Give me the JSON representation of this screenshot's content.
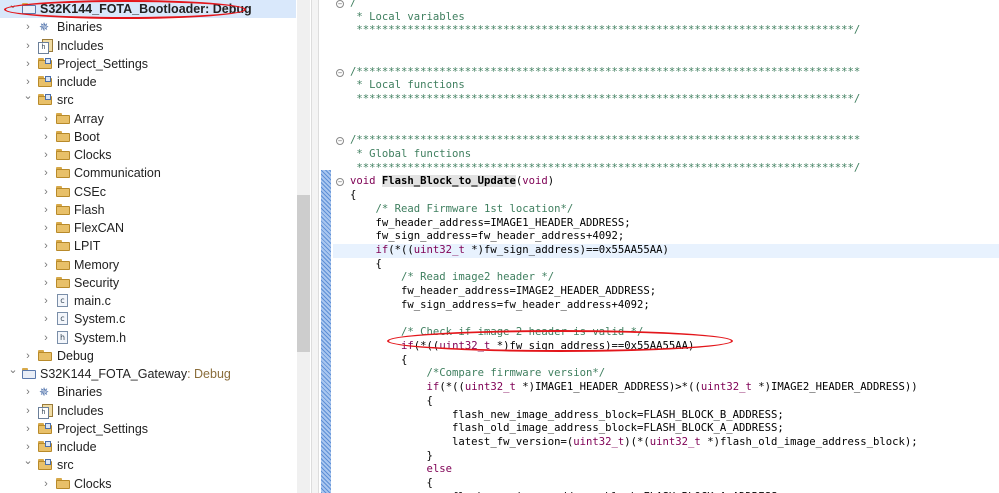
{
  "project_explorer": {
    "rows": [
      {
        "label": "S32K144_FOTA_Bootloader",
        "suffix": ": Debug",
        "icon": "project-folder-icon",
        "level": 0,
        "expanded": true,
        "selected": true
      },
      {
        "label": "Binaries",
        "icon": "binaries-icon",
        "level": 1,
        "expanded": false
      },
      {
        "label": "Includes",
        "icon": "includes-icon",
        "level": 1,
        "expanded": false
      },
      {
        "label": "Project_Settings",
        "icon": "source-folder-icon",
        "level": 1,
        "expanded": false
      },
      {
        "label": "include",
        "icon": "source-folder-icon",
        "level": 1,
        "expanded": false
      },
      {
        "label": "src",
        "icon": "source-folder-icon",
        "level": 1,
        "expanded": true
      },
      {
        "label": "Array",
        "icon": "folder-icon",
        "level": 2,
        "expanded": false
      },
      {
        "label": "Boot",
        "icon": "folder-icon",
        "level": 2,
        "expanded": false
      },
      {
        "label": "Clocks",
        "icon": "folder-icon",
        "level": 2,
        "expanded": false
      },
      {
        "label": "Communication",
        "icon": "folder-icon",
        "level": 2,
        "expanded": false
      },
      {
        "label": "CSEc",
        "icon": "folder-icon",
        "level": 2,
        "expanded": false
      },
      {
        "label": "Flash",
        "icon": "folder-icon",
        "level": 2,
        "expanded": false
      },
      {
        "label": "FlexCAN",
        "icon": "folder-icon",
        "level": 2,
        "expanded": false
      },
      {
        "label": "LPIT",
        "icon": "folder-icon",
        "level": 2,
        "expanded": false
      },
      {
        "label": "Memory",
        "icon": "folder-icon",
        "level": 2,
        "expanded": false
      },
      {
        "label": "Security",
        "icon": "folder-icon",
        "level": 2,
        "expanded": false
      },
      {
        "label": "main.c",
        "icon": "c-file-icon",
        "level": 2,
        "expanded": false
      },
      {
        "label": "System.c",
        "icon": "c-file-icon",
        "level": 2,
        "expanded": false
      },
      {
        "label": "System.h",
        "icon": "h-file-icon",
        "level": 2,
        "expanded": false
      },
      {
        "label": "Debug",
        "icon": "folder-icon",
        "level": 1,
        "expanded": false
      },
      {
        "label": "S32K144_FOTA_Gateway",
        "suffix": ": Debug",
        "icon": "project-folder-icon",
        "level": 0,
        "expanded": true
      },
      {
        "label": "Binaries",
        "icon": "binaries-icon",
        "level": 1,
        "expanded": false
      },
      {
        "label": "Includes",
        "icon": "includes-icon",
        "level": 1,
        "expanded": false
      },
      {
        "label": "Project_Settings",
        "icon": "source-folder-icon",
        "level": 1,
        "expanded": false
      },
      {
        "label": "include",
        "icon": "source-folder-icon",
        "level": 1,
        "expanded": false
      },
      {
        "label": "src",
        "icon": "source-folder-icon",
        "level": 1,
        "expanded": true
      },
      {
        "label": "Clocks",
        "icon": "folder-icon",
        "level": 2,
        "expanded": false
      }
    ]
  },
  "editor": {
    "lines": [
      {
        "fold": true,
        "tokens": [
          [
            "/",
            "c"
          ]
        ]
      },
      {
        "tokens": [
          [
            " * Local variables",
            "c"
          ]
        ]
      },
      {
        "tokens": [
          [
            " ******************************************************************************/",
            "c"
          ]
        ]
      },
      {
        "tokens": []
      },
      {
        "tokens": []
      },
      {
        "fold": true,
        "tokens": [
          [
            "/*******************************************************************************",
            "c"
          ]
        ]
      },
      {
        "tokens": [
          [
            " * Local functions",
            "c"
          ]
        ]
      },
      {
        "tokens": [
          [
            " ******************************************************************************/",
            "c"
          ]
        ]
      },
      {
        "tokens": []
      },
      {
        "tokens": []
      },
      {
        "fold": true,
        "tokens": [
          [
            "/*******************************************************************************",
            "c"
          ]
        ]
      },
      {
        "tokens": [
          [
            " * Global functions",
            "c"
          ]
        ]
      },
      {
        "tokens": [
          [
            " ******************************************************************************/",
            "c"
          ]
        ]
      },
      {
        "fold": true,
        "tokens": [
          [
            "void",
            "k"
          ],
          [
            " ",
            ""
          ],
          [
            "Flash_Block_to_Update",
            "fn"
          ],
          [
            "(",
            ""
          ],
          [
            "void",
            "k"
          ],
          [
            ")",
            ""
          ]
        ]
      },
      {
        "tokens": [
          [
            "{",
            ""
          ]
        ]
      },
      {
        "tokens": [
          [
            "    ",
            ""
          ],
          [
            "/* Read Firmware 1st location*/",
            "c"
          ]
        ]
      },
      {
        "tokens": [
          [
            "    fw_header_address=IMAGE1_HEADER_ADDRESS;",
            ""
          ]
        ]
      },
      {
        "tokens": [
          [
            "    fw_sign_address=fw_header_address+4092;",
            ""
          ]
        ]
      },
      {
        "highlight": true,
        "tokens": [
          [
            "    ",
            ""
          ],
          [
            "if",
            "k"
          ],
          [
            "(*((",
            ""
          ],
          [
            "uint32_t",
            "k"
          ],
          [
            " *)fw_sign_address)==0x55AA55AA)",
            ""
          ]
        ]
      },
      {
        "tokens": [
          [
            "    {",
            ""
          ]
        ]
      },
      {
        "tokens": [
          [
            "        ",
            ""
          ],
          [
            "/* Read image2 header */",
            "c"
          ]
        ]
      },
      {
        "tokens": [
          [
            "        fw_header_address=IMAGE2_HEADER_ADDRESS;",
            ""
          ]
        ]
      },
      {
        "tokens": [
          [
            "        fw_sign_address=fw_header_address+4092;",
            ""
          ]
        ]
      },
      {
        "tokens": []
      },
      {
        "tokens": [
          [
            "        ",
            ""
          ],
          [
            "/* Check if image 2 header is valid */",
            "c"
          ]
        ]
      },
      {
        "tokens": [
          [
            "        ",
            ""
          ],
          [
            "if",
            "k"
          ],
          [
            "(*((",
            ""
          ],
          [
            "uint32_t",
            "k"
          ],
          [
            " *)fw_sign_address)==0x55AA55AA)",
            ""
          ]
        ]
      },
      {
        "tokens": [
          [
            "        {",
            ""
          ]
        ]
      },
      {
        "tokens": [
          [
            "            ",
            ""
          ],
          [
            "/*Compare firmware version*/",
            "c"
          ]
        ]
      },
      {
        "tokens": [
          [
            "            ",
            ""
          ],
          [
            "if",
            "k"
          ],
          [
            "(*((",
            ""
          ],
          [
            "uint32_t",
            "k"
          ],
          [
            " *)IMAGE1_HEADER_ADDRESS)>*((",
            ""
          ],
          [
            "uint32_t",
            "k"
          ],
          [
            " *)IMAGE2_HEADER_ADDRESS))",
            ""
          ]
        ]
      },
      {
        "tokens": [
          [
            "            {",
            ""
          ]
        ]
      },
      {
        "tokens": [
          [
            "                flash_new_image_address_block=FLASH_BLOCK_B_ADDRESS;",
            ""
          ]
        ]
      },
      {
        "tokens": [
          [
            "                flash_old_image_address_block=FLASH_BLOCK_A_ADDRESS;",
            ""
          ]
        ]
      },
      {
        "tokens": [
          [
            "                latest_fw_version=(",
            ""
          ],
          [
            "uint32_t",
            "k"
          ],
          [
            ")(*(",
            ""
          ],
          [
            "uint32_t",
            "k"
          ],
          [
            " *)flash_old_image_address_block);",
            ""
          ]
        ]
      },
      {
        "tokens": [
          [
            "            }",
            ""
          ]
        ]
      },
      {
        "tokens": [
          [
            "            ",
            ""
          ],
          [
            "else",
            "k"
          ]
        ]
      },
      {
        "tokens": [
          [
            "            {",
            ""
          ]
        ]
      },
      {
        "tokens": [
          [
            "                flash_new_image_address_block=FLASH_BLOCK_A_ADDRESS;",
            ""
          ]
        ]
      }
    ]
  },
  "colors": {
    "keyword": "#7f0055",
    "comment": "#3f7f5f",
    "annotation": "#e3161b",
    "selection": "#d9e8fb"
  }
}
